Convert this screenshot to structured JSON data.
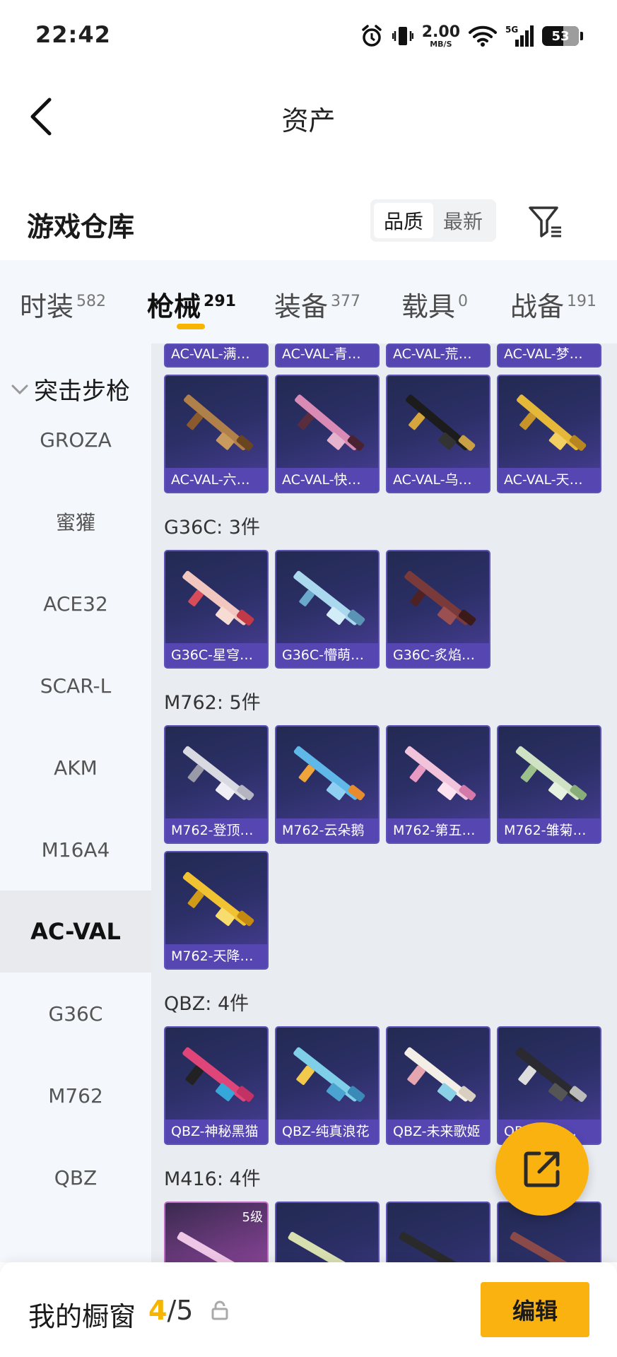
{
  "status_bar": {
    "time": "22:42",
    "net_speed": "2.00",
    "net_speed_unit": "MB/S",
    "signal_label": "5G",
    "battery": "53"
  },
  "header": {
    "title": "资产",
    "back_icon": "chevron-left-icon"
  },
  "warehouse": {
    "title": "游戏仓库",
    "sort_options": [
      "品质",
      "最新"
    ],
    "sort_selected": "品质",
    "filter_icon": "filter-icon"
  },
  "tabs": [
    {
      "label": "时装",
      "count": "582"
    },
    {
      "label": "枪械",
      "count": "291",
      "active": true
    },
    {
      "label": "装备",
      "count": "377"
    },
    {
      "label": "载具",
      "count": "0"
    },
    {
      "label": "战备",
      "count": "191"
    }
  ],
  "sidebar": {
    "category": "突击步枪",
    "items": [
      "GROZA",
      "蜜獾",
      "ACE32",
      "SCAR-L",
      "AKM",
      "M16A4",
      "AC-VAL",
      "G36C",
      "M762",
      "QBZ"
    ],
    "active": "AC-VAL"
  },
  "content": {
    "acval_partial": [
      "AC-VAL-满月...",
      "AC-VAL-青梨...",
      "AC-VAL-荒原...",
      "AC-VAL-梦海..."
    ],
    "acval_row": [
      "AC-VAL-六号...",
      "AC-VAL-快闪...",
      "AC-VAL-乌木...",
      "AC-VAL-天降..."
    ],
    "g36c_label": "G36C: 3件",
    "g36c": [
      "G36C-星穹咏...",
      "G36C-懵萌河...",
      "G36C-炙焰牛..."
    ],
    "m762_label": "M762: 5件",
    "m762": [
      "M762-登顶巅...",
      "M762-云朵鹅",
      "M762-第五大...",
      "M762-雏菊兔...",
      "M762-天降萌..."
    ],
    "qbz_label": "QBZ: 4件",
    "qbz": [
      "QBZ-神秘黑猫",
      "QBZ-纯真浪花",
      "QBZ-未来歌姬",
      "QBZ-...小..."
    ],
    "m416_label": "M416: 4件",
    "m416_badge": "5级"
  },
  "colors": {
    "accent": "#f9b20f",
    "card_bg": "#2b2f66",
    "card_caption": "#5546b2",
    "page_bg": "#e9ecf1",
    "sidebar_bg": "#f4f7fb"
  },
  "fab": {
    "icon": "share-external-icon"
  },
  "bottom_bar": {
    "label": "我的橱窗",
    "current": "4",
    "total": "5",
    "lock_icon": "lock-icon",
    "edit_label": "编辑"
  }
}
